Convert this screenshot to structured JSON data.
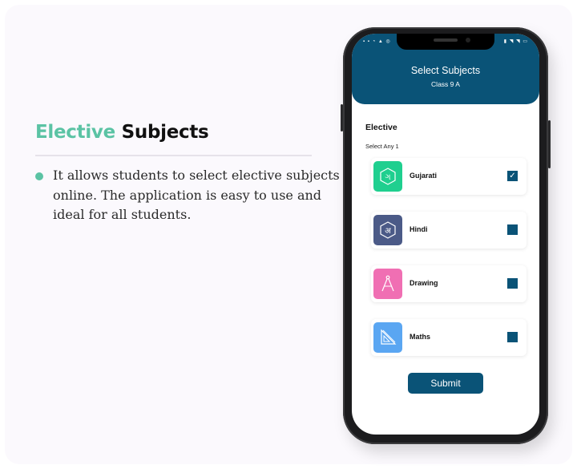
{
  "promo": {
    "title_accent": "Elective",
    "title_rest": "Subjects",
    "bullet": "It allows students to select elective subjects online. The application is easy to use and ideal for all students."
  },
  "app": {
    "header_title": "Select Subjects",
    "header_subtitle": "Class 9 A",
    "section_title": "Elective",
    "section_hint": "Select Any 1",
    "subjects": [
      {
        "label": "Gujarati",
        "icon": "gujarati-script-icon",
        "color": "#1fcf8f",
        "checked": true
      },
      {
        "label": "Hindi",
        "icon": "hindi-script-icon",
        "color": "#4b5a87",
        "checked": false
      },
      {
        "label": "Drawing",
        "icon": "compass-icon",
        "color": "#f06fb3",
        "checked": false
      },
      {
        "label": "Maths",
        "icon": "ruler-triangle-icon",
        "color": "#5aa6f2",
        "checked": false
      }
    ],
    "submit_label": "Submit"
  },
  "colors": {
    "accent": "#5bc3a4",
    "primary": "#0a5377"
  }
}
